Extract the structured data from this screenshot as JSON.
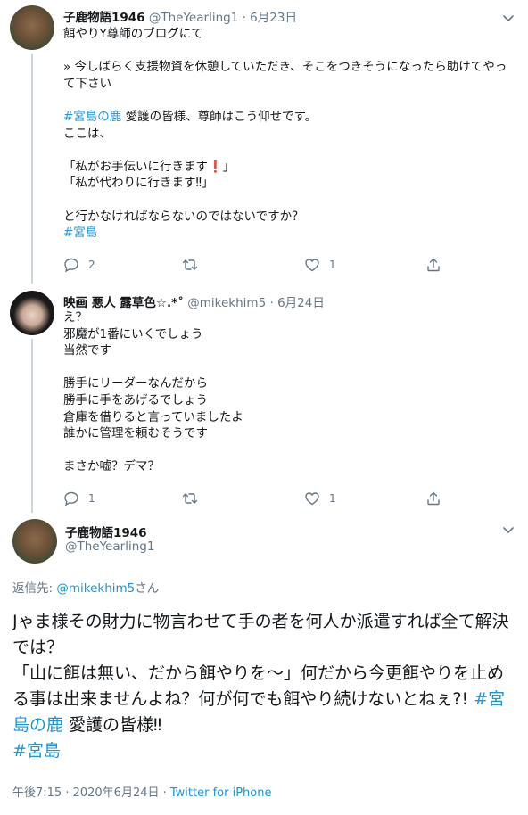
{
  "tweet1": {
    "name": "子鹿物語1946",
    "handle": "@TheYearling1",
    "separator": "·",
    "date": "6月23日",
    "text_a": "餌やりY尊師のブログにて\n\n» 今しばらく支援物資を休憩していただき、そこをつきそうになったら助けてやって下さい\n\n",
    "hashtag1": "#宮島の鹿",
    "text_b": " 愛護の皆様、尊師はこう仰せです。\nここは、\n\n「私がお手伝いに行きます❗」\n「私が代わりに行きます‼」\n\nと行かなければならないのではないですか？\n",
    "hashtag2": "#宮島",
    "reply_count": "2",
    "retweet_count": "",
    "like_count": "1"
  },
  "tweet2": {
    "name": "映画 悪人 露草色☆.*˚",
    "handle": "@mikekhim5",
    "separator": "·",
    "date": "6月24日",
    "text": "え？\n邪魔が1番にいくでしょう\n当然です\n\n勝手にリーダーなんだから\n勝手に手をあげるでしょう\n倉庫を借りると言っていましたよ\n誰かに管理を頼むそうです\n\nまさか嘘？デマ？",
    "reply_count": "1",
    "retweet_count": "",
    "like_count": "1"
  },
  "main": {
    "name": "子鹿物語1946",
    "handle": "@TheYearling1",
    "reply_prefix": "返信先: ",
    "reply_handle": "@mikekhim5",
    "reply_suffix": "さん",
    "text_a": "Jゃま様その財力に物言わせて手の者を何人か派遣すれば全て解決では？\n「山に餌は無い、だから餌やりを～」何だから今更餌やりを止める事は出来ませんよね？何が何でも餌やり続けないとねぇ?! ",
    "hashtag1": "#宮島の鹿",
    "text_b": " 愛護の皆様‼\n",
    "hashtag2": "#宮島",
    "timestamp": "午後7:15 · 2020年6月24日 · ",
    "source": "Twitter for iPhone"
  },
  "icons": {
    "reply": "reply-icon",
    "retweet": "retweet-icon",
    "like": "heart-icon",
    "share": "share-icon",
    "more": "chevron-down-icon"
  },
  "colors": {
    "link": "#1b95e0",
    "secondary": "#657786",
    "thread_line": "#ccd6dd"
  }
}
